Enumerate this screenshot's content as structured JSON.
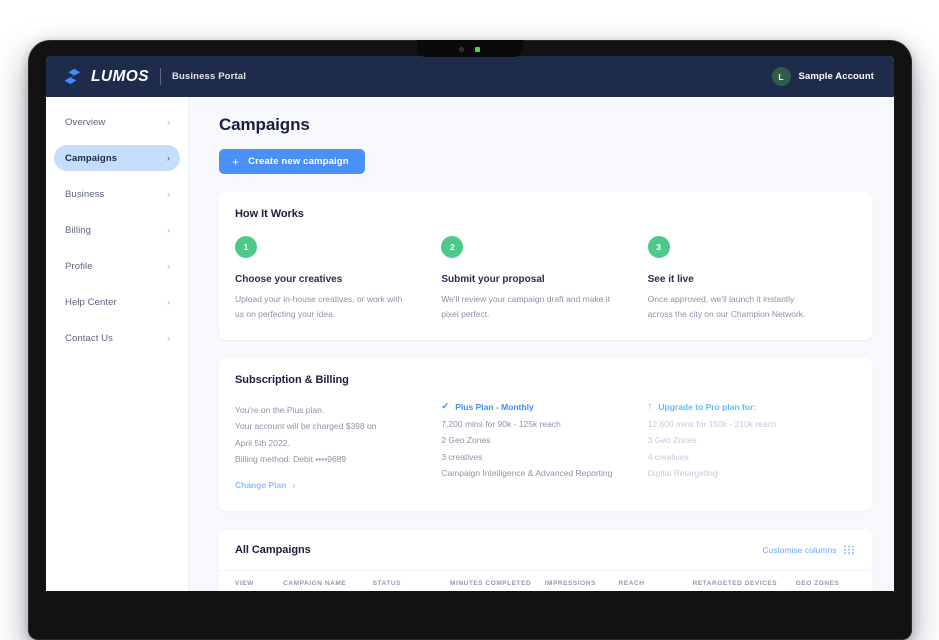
{
  "topbar": {
    "logo_icon": "lumos-bolt-logo",
    "logo_text": "LUMOS",
    "portal_label": "Business Portal",
    "account": {
      "avatar_initial": "L",
      "name": "Sample Account"
    }
  },
  "sidebar": {
    "items": [
      {
        "label": "Overview",
        "active": false
      },
      {
        "label": "Campaigns",
        "active": true
      },
      {
        "label": "Business",
        "active": false
      },
      {
        "label": "Billing",
        "active": false
      },
      {
        "label": "Profile",
        "active": false
      },
      {
        "label": "Help Center",
        "active": false
      },
      {
        "label": "Contact Us",
        "active": false
      }
    ],
    "chevron": "›"
  },
  "main": {
    "page_title": "Campaigns",
    "create_button": {
      "label": "Create new campaign",
      "plus": "+"
    },
    "how_it_works": {
      "title": "How It Works",
      "steps": [
        {
          "number": "1",
          "heading": "Choose your creatives",
          "description": "Upload your in-house creatives, or work with us on perfecting your idea."
        },
        {
          "number": "2",
          "heading": "Submit your proposal",
          "description": "We'll review your campaign draft and make it pixel perfect."
        },
        {
          "number": "3",
          "heading": "See it live",
          "description": "Once approved, we'll launch it instantly across the city on our Champion Network."
        }
      ]
    },
    "subscription": {
      "title": "Subscription & Billing",
      "account_lines": [
        "You're on the Plus plan.",
        "Your account will be charged $398 on",
        "April 5th 2022.",
        "Billing method: Debit ••••9689"
      ],
      "change_plan_label": "Change Plan",
      "change_plan_chevron": "›",
      "current_plan": {
        "tick": "✓",
        "heading": "Plus Plan - Monthly",
        "features": [
          "7,200 mins for 90k - 125k reach",
          "2 Geo Zones",
          "3 creatives",
          "Campaign Intelligence & Advanced Reporting"
        ]
      },
      "upgrade_plan": {
        "uparrow": "↑",
        "heading": "Upgrade to Pro plan for:",
        "features": [
          "12,600 mins for 150k - 210k reach",
          "3 Geo Zones",
          "4 creatives",
          "Digital Retargeting"
        ]
      }
    },
    "all_campaigns": {
      "title": "All Campaigns",
      "customise_label": "Customise columns",
      "customise_icon": "columns-grid-icon",
      "columns": [
        "VIEW",
        "CAMPAIGN NAME",
        "STATUS",
        "MINUTES COMPLETED",
        "IMPRESSIONS",
        "REACH",
        "RETARGETED DEVICES",
        "GEO ZONES"
      ]
    }
  },
  "colors": {
    "topbar": "#1e2b4a",
    "accent_blue": "#4a90f7",
    "active_nav": "#c6ddfb",
    "step_green": "#4dc98a",
    "page_bg": "#f7f8fc"
  }
}
